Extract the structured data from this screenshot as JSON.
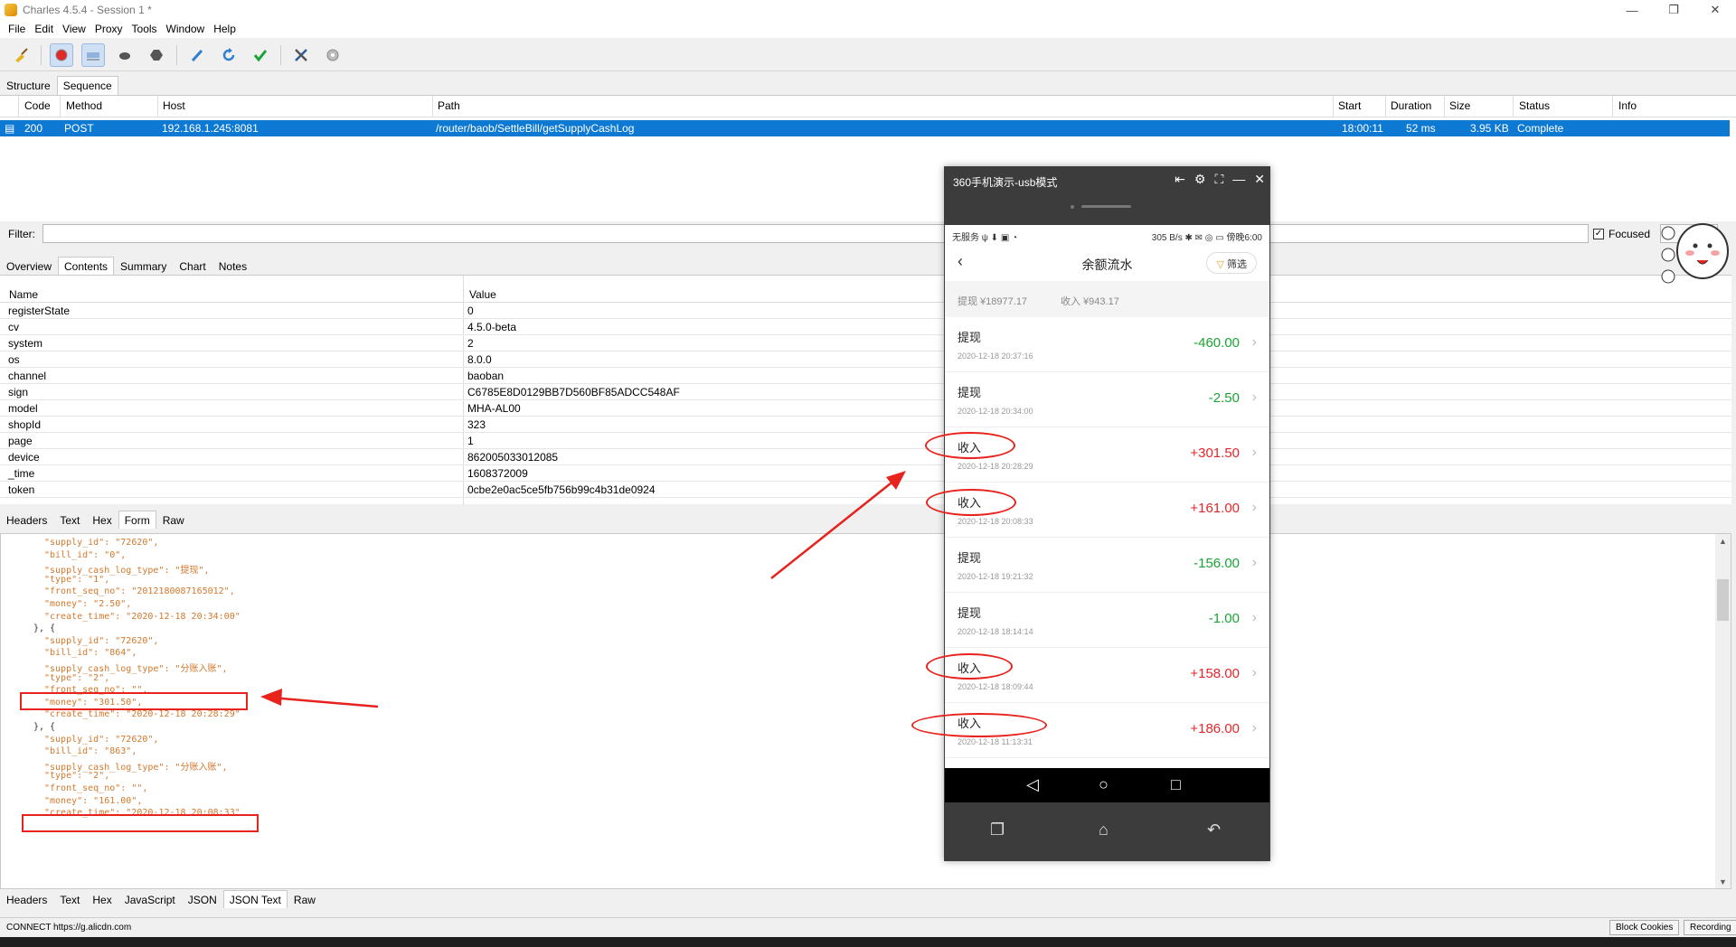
{
  "window": {
    "title": "Charles 4.5.4 - Session 1 *"
  },
  "menu": [
    "File",
    "Edit",
    "View",
    "Proxy",
    "Tools",
    "Window",
    "Help"
  ],
  "top_tabs": [
    "Structure",
    "Sequence"
  ],
  "sequence": {
    "columns": [
      "Code",
      "Method",
      "Host",
      "Path",
      "Start",
      "Duration",
      "Size",
      "Status",
      "Info"
    ],
    "row": {
      "code": "200",
      "method": "POST",
      "host": "192.168.1.245:8081",
      "path": "/router/baob/SettleBill/getSupplyCashLog",
      "start": "18:00:11",
      "duration": "52 ms",
      "size": "3.95 KB",
      "status": "Complete",
      "info": ""
    }
  },
  "filter": {
    "label": "Filter:",
    "value": "",
    "focused_label": "Focused"
  },
  "detail_tabs": [
    "Overview",
    "Contents",
    "Summary",
    "Chart",
    "Notes"
  ],
  "params": {
    "columns": [
      "Name",
      "Value"
    ],
    "rows": [
      {
        "name": "registerState",
        "value": "0"
      },
      {
        "name": "cv",
        "value": "4.5.0-beta"
      },
      {
        "name": "system",
        "value": "2"
      },
      {
        "name": "os",
        "value": "8.0.0"
      },
      {
        "name": "channel",
        "value": "baoban"
      },
      {
        "name": "sign",
        "value": "C6785E8D0129BB7D560BF85ADCC548AF"
      },
      {
        "name": "model",
        "value": "MHA-AL00"
      },
      {
        "name": "shopId",
        "value": "323"
      },
      {
        "name": "page",
        "value": "1"
      },
      {
        "name": "device",
        "value": "862005033012085"
      },
      {
        "name": "_time",
        "value": "1608372009"
      },
      {
        "name": "token",
        "value": "0cbe2e0ac5ce5fb756b99c4b31de0924"
      }
    ]
  },
  "request_tabs": [
    "Headers",
    "Text",
    "Hex",
    "Form",
    "Raw"
  ],
  "json_lines": [
    "\"supply_id\": \"72620\",",
    "\"bill_id\": \"0\",",
    "\"supply_cash_log_type\": \"提现\",",
    "\"type\": \"1\",",
    "\"front_seq_no\": \"2012180087165012\",",
    "\"money\": \"2.50\",",
    "\"create_time\": \"2020-12-18 20:34:00\"",
    "}, {",
    "\"supply_id\": \"72620\",",
    "\"bill_id\": \"864\",",
    "\"supply_cash_log_type\": \"分账入账\",",
    "\"type\": \"2\",",
    "\"front_seq_no\": \"\",",
    "\"money\": \"301.50\",",
    "\"create_time\": \"2020-12-18 20:28:29\"",
    "}, {",
    "\"supply_id\": \"72620\",",
    "\"bill_id\": \"863\",",
    "\"supply_cash_log_type\": \"分账入账\",",
    "\"type\": \"2\",",
    "\"front_seq_no\": \"\",",
    "\"money\": \"161.00\",",
    "\"create_time\": \"2020-12-18 20:08:33\""
  ],
  "response_tabs": [
    "Headers",
    "Text",
    "Hex",
    "JavaScript",
    "JSON",
    "JSON Text",
    "Raw"
  ],
  "status_bar": {
    "message": "CONNECT https://g.alicdn.com",
    "block_cookies": "Block Cookies",
    "recording": "Recording"
  },
  "phone": {
    "window_title": "360手机演示-usb模式",
    "status_left": "无服务 ψ ⬇ ▣ ◔",
    "status_right": "305 B/s ✱ ✉ ◎ ▭ 傍晚6:00",
    "page_title": "余额流水",
    "filter_button": "筛选",
    "summary_withdraw": "提现 ¥18977.17",
    "summary_income": "收入 ¥943.17",
    "items": [
      {
        "label": "提现",
        "time": "2020-12-18 20:37:16",
        "amount": "-460.00",
        "kind": "green"
      },
      {
        "label": "提现",
        "time": "2020-12-18 20:34:00",
        "amount": "-2.50",
        "kind": "green"
      },
      {
        "label": "收入",
        "time": "2020-12-18 20:28:29",
        "amount": "+301.50",
        "kind": "red"
      },
      {
        "label": "收入",
        "time": "2020-12-18 20:08:33",
        "amount": "+161.00",
        "kind": "red"
      },
      {
        "label": "提现",
        "time": "2020-12-18 19:21:32",
        "amount": "-156.00",
        "kind": "green"
      },
      {
        "label": "提现",
        "time": "2020-12-18 18:14:14",
        "amount": "-1.00",
        "kind": "green"
      },
      {
        "label": "收入",
        "time": "2020-12-18 18:09:44",
        "amount": "+158.00",
        "kind": "red"
      },
      {
        "label": "收入",
        "time": "2020-12-18 11:13:31",
        "amount": "+186.00",
        "kind": "red"
      }
    ]
  },
  "colors": {
    "selection": "#0d79d3",
    "annotation": "#e8221c",
    "income": "#e5262a",
    "withdraw": "#1aa334"
  }
}
